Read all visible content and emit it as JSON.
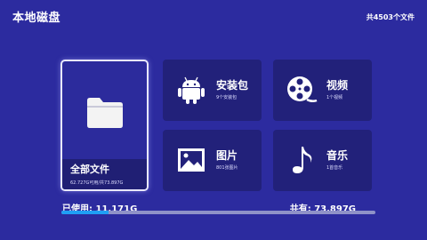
{
  "header": {
    "title": "本地磁盘",
    "file_count": "共4503个文件"
  },
  "main_tile": {
    "icon": "folder-icon",
    "label": "全部文件",
    "sub": "62.727G可用/共73.897G"
  },
  "tiles": [
    {
      "icon": "android-icon",
      "label": "安装包",
      "sub": "9个安装包"
    },
    {
      "icon": "film-reel-icon",
      "label": "视频",
      "sub": "1个视频"
    },
    {
      "icon": "image-icon",
      "label": "图片",
      "sub": "801张图片"
    },
    {
      "icon": "music-note-icon",
      "label": "音乐",
      "sub": "1首音乐"
    }
  ],
  "storage": {
    "used_label": "已使用: 11.171G",
    "total_label": "共有: 73.897G",
    "used_fraction": 0.151
  },
  "colors": {
    "background": "#2c2b9f",
    "tile": "#22217a",
    "progress": "#1f9ff5",
    "track": "#8f92c8"
  }
}
